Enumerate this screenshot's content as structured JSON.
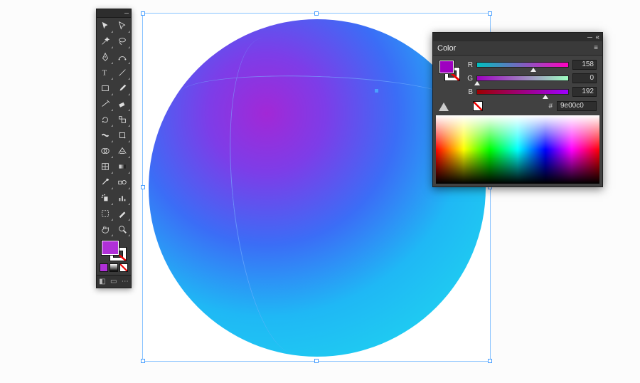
{
  "app": "Adobe Illustrator",
  "toolbar": {
    "tools": [
      "selection-tool",
      "direct-selection-tool",
      "magic-wand-tool",
      "lasso-tool",
      "pen-tool",
      "curvature-tool",
      "type-tool",
      "line-segment-tool",
      "rectangle-tool",
      "paintbrush-tool",
      "shaper-tool",
      "eraser-tool",
      "rotate-tool",
      "scale-tool",
      "width-tool",
      "free-transform-tool",
      "shape-builder-tool",
      "perspective-grid-tool",
      "mesh-tool",
      "gradient-tool",
      "eyedropper-tool",
      "blend-tool",
      "symbol-sprayer-tool",
      "column-graph-tool",
      "artboard-tool",
      "slice-tool",
      "hand-tool",
      "zoom-tool"
    ],
    "fill_color": "#b030d8",
    "stroke_color": "none",
    "draw_modes": [
      "draw-normal",
      "draw-behind",
      "draw-inside"
    ],
    "screen_mode": "normal"
  },
  "canvas": {
    "object": "mesh-ellipse",
    "selected": true,
    "gradient_colors": [
      "#a228d6",
      "#1fd6ec"
    ]
  },
  "color_panel": {
    "title": "Color",
    "mode": "RGB",
    "channels": {
      "R": {
        "label": "R",
        "value": 158,
        "pct": 62
      },
      "G": {
        "label": "G",
        "value": 0,
        "pct": 0
      },
      "B": {
        "label": "B",
        "value": 192,
        "pct": 75
      }
    },
    "hex_label": "#",
    "hex": "9e00c0",
    "fill_swatch": "#9e00c0",
    "stroke_swatch": "none"
  }
}
